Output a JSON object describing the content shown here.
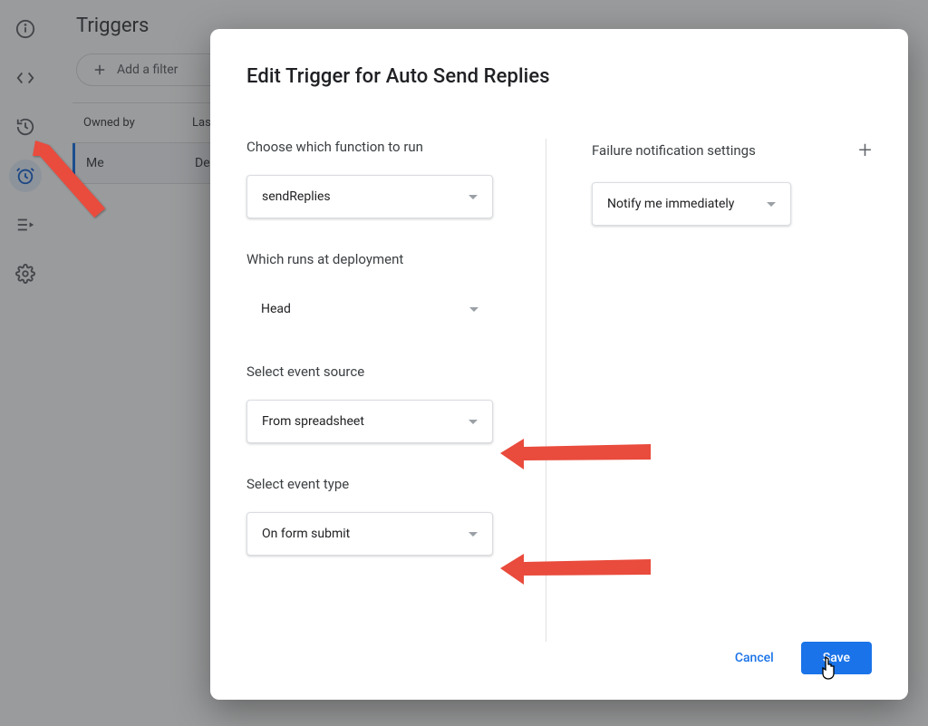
{
  "page": {
    "title": "Triggers",
    "filter_label": "Add a filter"
  },
  "table": {
    "headers": {
      "owned_by": "Owned by",
      "last_run": "Las"
    },
    "rows": [
      {
        "owned_by": "Me",
        "last_run": "Dec"
      }
    ]
  },
  "dialog": {
    "title": "Edit Trigger for Auto Send Replies",
    "function_label": "Choose which function to run",
    "function_value": "sendReplies",
    "deployment_label": "Which runs at deployment",
    "deployment_value": "Head",
    "source_label": "Select event source",
    "source_value": "From spreadsheet",
    "type_label": "Select event type",
    "type_value": "On form submit",
    "failure_label": "Failure notification settings",
    "failure_value": "Notify me immediately",
    "cancel": "Cancel",
    "save": "Save"
  }
}
